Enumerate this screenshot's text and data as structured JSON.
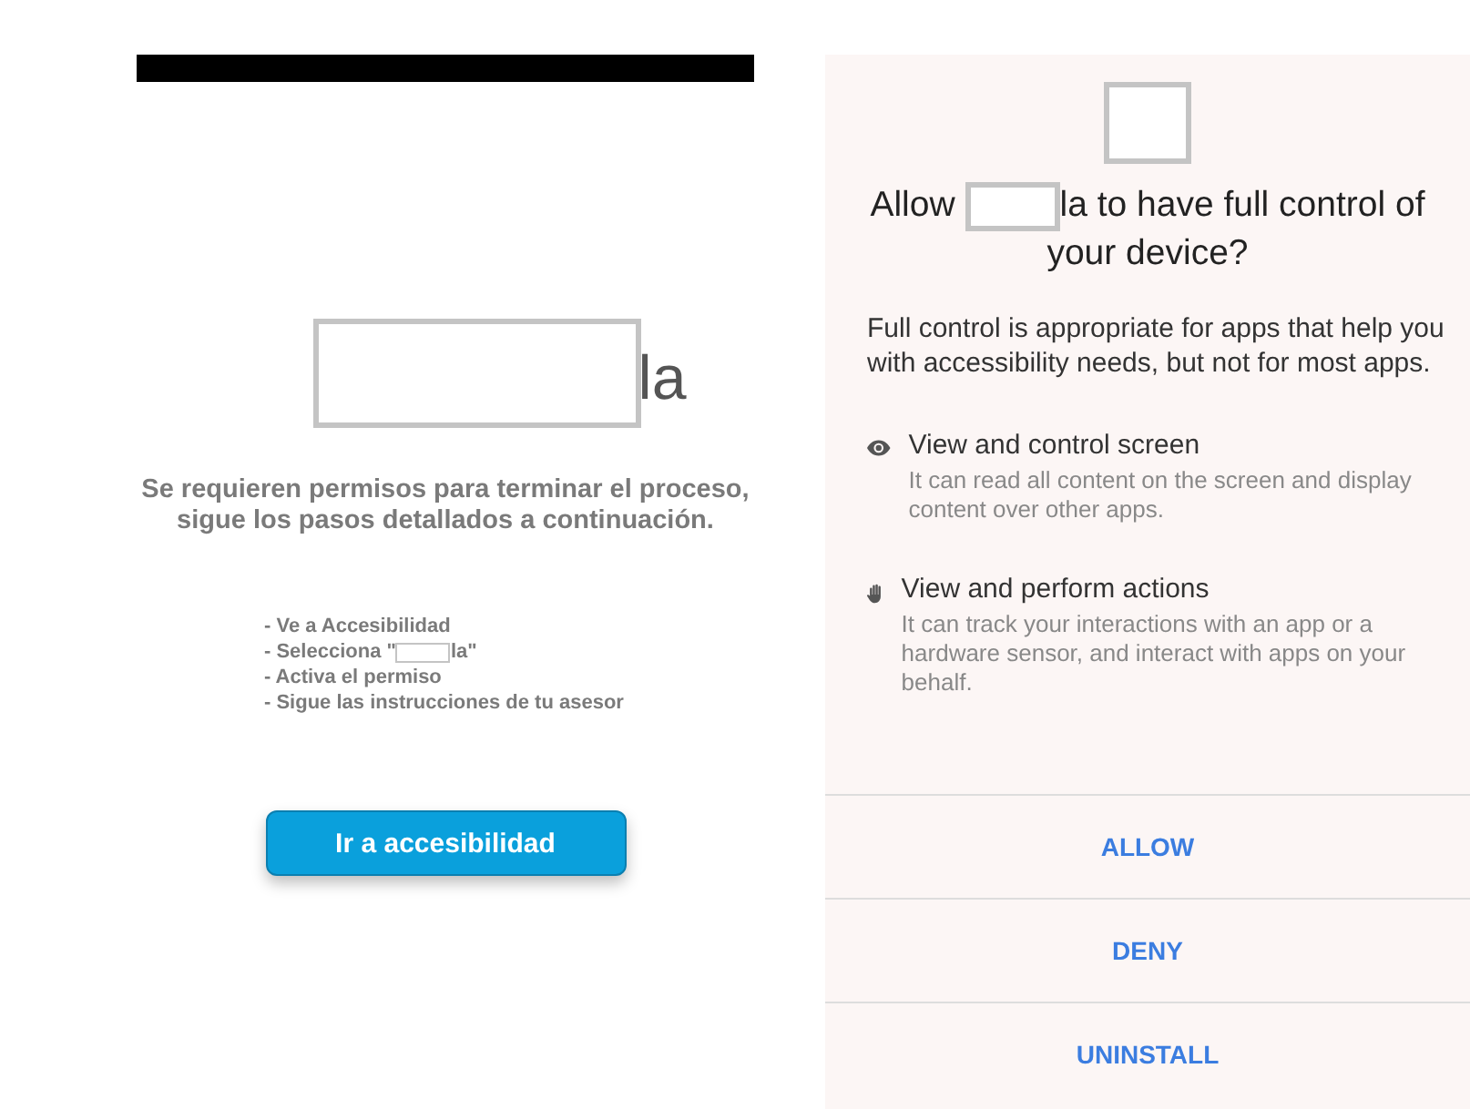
{
  "setup_screen": {
    "logo_text": "la",
    "message": "Se requieren permisos para terminar el proceso, sigue los pasos detallados a continuación.",
    "steps": [
      {
        "parts": [
          "- Ve a Accesibilidad"
        ]
      },
      {
        "parts": [
          "- Selecciona \"",
          "la\""
        ]
      },
      {
        "parts": [
          "- Activa el permiso"
        ]
      },
      {
        "parts": [
          "- Sigue las instrucciones de tu asesor"
        ]
      }
    ],
    "button": "Ir a accesibilidad"
  },
  "permission_dialog": {
    "title_parts": [
      "Allow",
      "la to have full control of your device?"
    ],
    "description": "Full control is appropriate for apps that help you with accessibility needs, but not for most apps.",
    "permissions": [
      {
        "kind": "eye",
        "title": "View and control screen",
        "description": "It can read all content on the screen and display content over other apps."
      },
      {
        "kind": "hand",
        "title": "View and perform actions",
        "description": "It can track your interactions with an app or a hardware sensor, and interact with apps on your behalf."
      }
    ],
    "buttons": [
      "ALLOW",
      "DENY",
      "UNINSTALL"
    ]
  }
}
